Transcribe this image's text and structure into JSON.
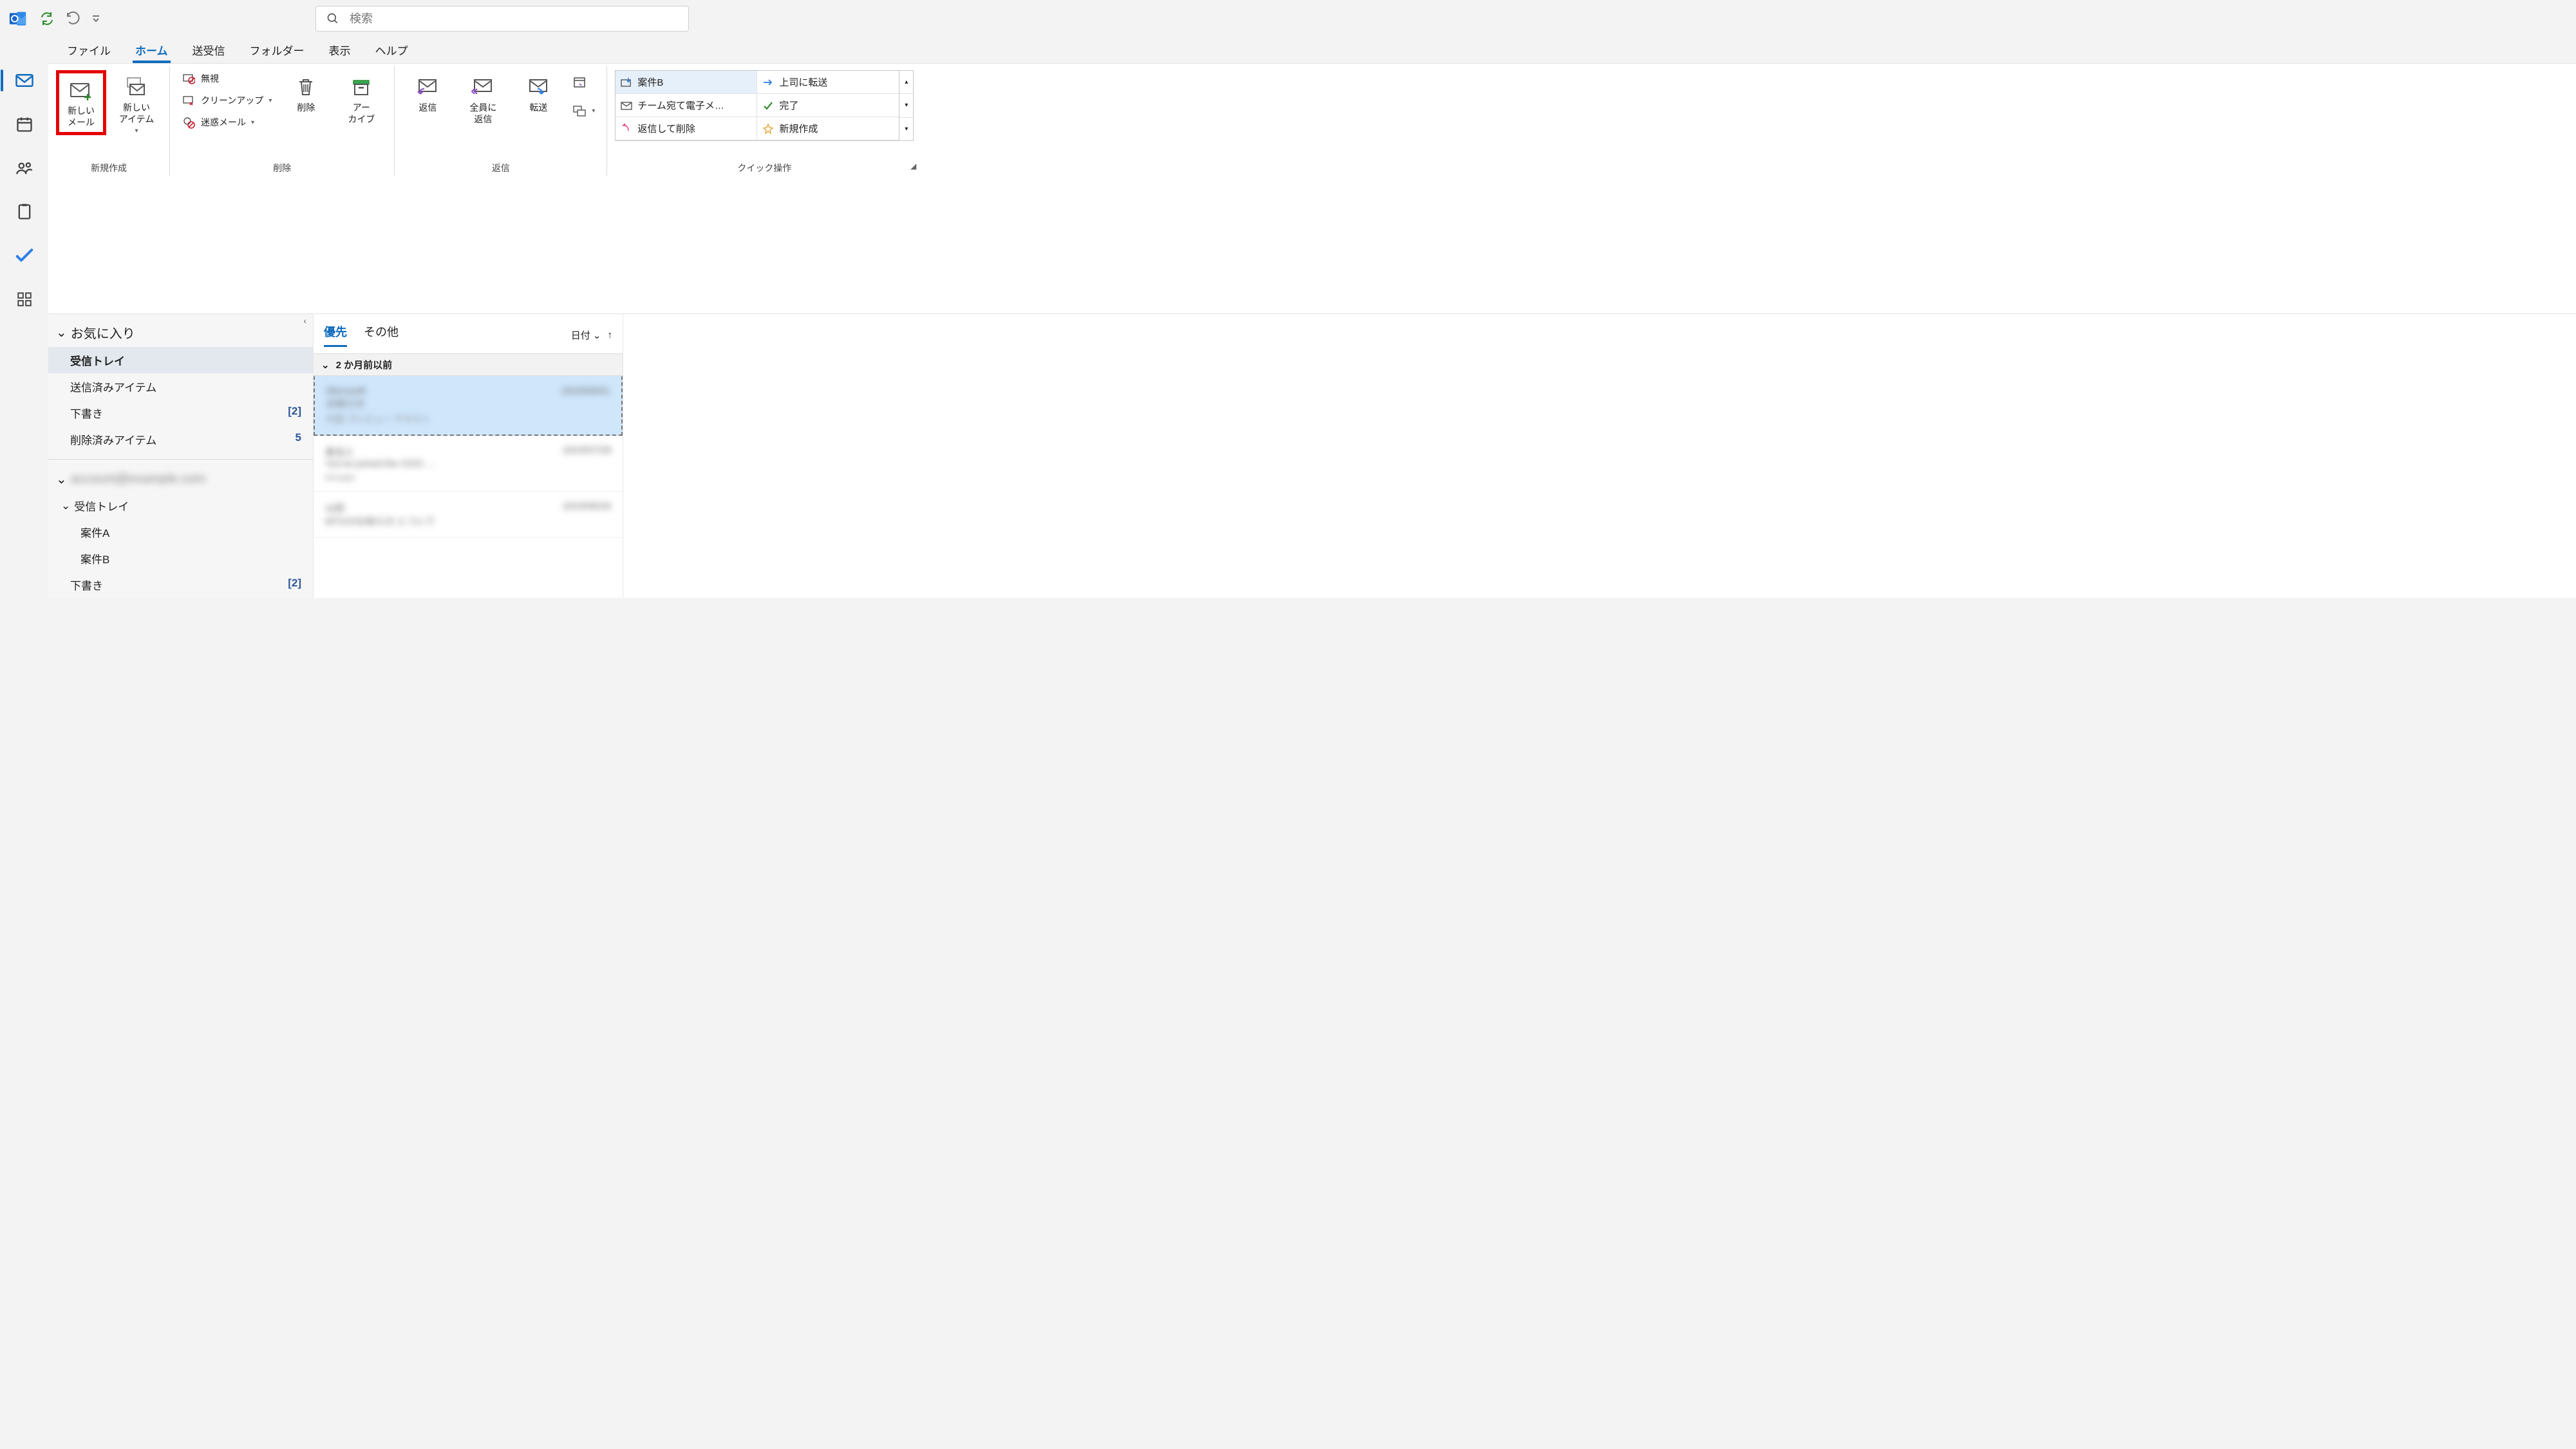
{
  "search": {
    "placeholder": "検索"
  },
  "tabs": {
    "file": "ファイル",
    "home": "ホーム",
    "sendreceive": "送受信",
    "folder": "フォルダー",
    "view": "表示",
    "help": "ヘルプ"
  },
  "ribbon": {
    "group_new": "新規作成",
    "new_mail": "新しい\nメール",
    "new_items": "新しい\nアイテム",
    "group_delete": "削除",
    "ignore": "無視",
    "cleanup": "クリーンアップ",
    "junk": "迷惑メール",
    "delete": "削除",
    "archive": "アー\nカイブ",
    "group_respond": "返信",
    "reply": "返信",
    "reply_all": "全員に\n返信",
    "forward": "転送",
    "group_quick": "クイック操作",
    "qs1": "案件B",
    "qs2": "上司に転送",
    "qs3": "チーム宛て電子メ…",
    "qs4": "完了",
    "qs5": "返信して削除",
    "qs6": "新規作成"
  },
  "folders": {
    "favorites": "お気に入り",
    "inbox": "受信トレイ",
    "sent": "送信済みアイテム",
    "drafts": "下書き",
    "drafts_count": "[2]",
    "deleted": "削除済みアイテム",
    "deleted_count": "5",
    "account_blurred": "account@example.com",
    "inbox2": "受信トレイ",
    "folder_a": "案件A",
    "folder_b": "案件B",
    "drafts2": "下書き",
    "drafts2_count": "[2]"
  },
  "msglist": {
    "focused": "優先",
    "other": "その他",
    "sort_label": "日付",
    "group_header": "2 か月前以前"
  },
  "messages": [
    {
      "from": "Microsoft",
      "subject": "お知らせ",
      "date": "2023/09/01",
      "preview": "内容 プレビュー テキスト"
    },
    {
      "from": "差出人",
      "subject": "You've joined the OOO …",
      "date": "2023/07/28",
      "preview": "Groups"
    },
    {
      "from": "山田",
      "subject": "MTGのお知らせ について",
      "date": "2023/06/26",
      "preview": ""
    }
  ]
}
